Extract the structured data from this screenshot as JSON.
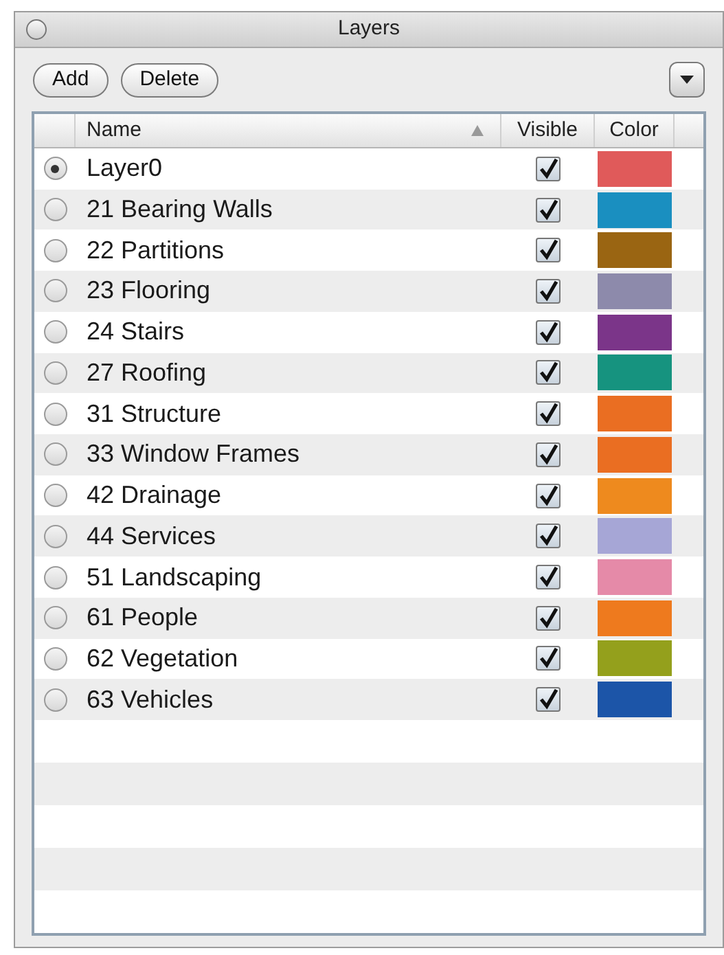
{
  "window": {
    "title": "Layers"
  },
  "buttons": [
    "Add",
    "Delete"
  ],
  "table": {
    "columns": [
      "Name",
      "Visible",
      "Color"
    ],
    "rows": [
      {
        "name": "Layer0",
        "selected": true,
        "visible": true,
        "color": "#e05a5a"
      },
      {
        "name": "21 Bearing Walls",
        "selected": false,
        "visible": true,
        "color": "#1a8fc0"
      },
      {
        "name": "22 Partitions",
        "selected": false,
        "visible": true,
        "color": "#9a6512"
      },
      {
        "name": "23 Flooring",
        "selected": false,
        "visible": true,
        "color": "#8d8aab"
      },
      {
        "name": "24 Stairs",
        "selected": false,
        "visible": true,
        "color": "#7b3589"
      },
      {
        "name": "27 Roofing",
        "selected": false,
        "visible": true,
        "color": "#16937f"
      },
      {
        "name": "31 Structure",
        "selected": false,
        "visible": true,
        "color": "#ea6e22"
      },
      {
        "name": "33 Window Frames",
        "selected": false,
        "visible": true,
        "color": "#ea6e22"
      },
      {
        "name": "42 Drainage",
        "selected": false,
        "visible": true,
        "color": "#ee8a1e"
      },
      {
        "name": "44 Services",
        "selected": false,
        "visible": true,
        "color": "#a6a6d6"
      },
      {
        "name": "51 Landscaping",
        "selected": false,
        "visible": true,
        "color": "#e58aa8"
      },
      {
        "name": "61 People",
        "selected": false,
        "visible": true,
        "color": "#ee7a1e"
      },
      {
        "name": "62 Vegetation",
        "selected": false,
        "visible": true,
        "color": "#94a01c"
      },
      {
        "name": "63 Vehicles",
        "selected": false,
        "visible": true,
        "color": "#1c55a8"
      }
    ]
  }
}
